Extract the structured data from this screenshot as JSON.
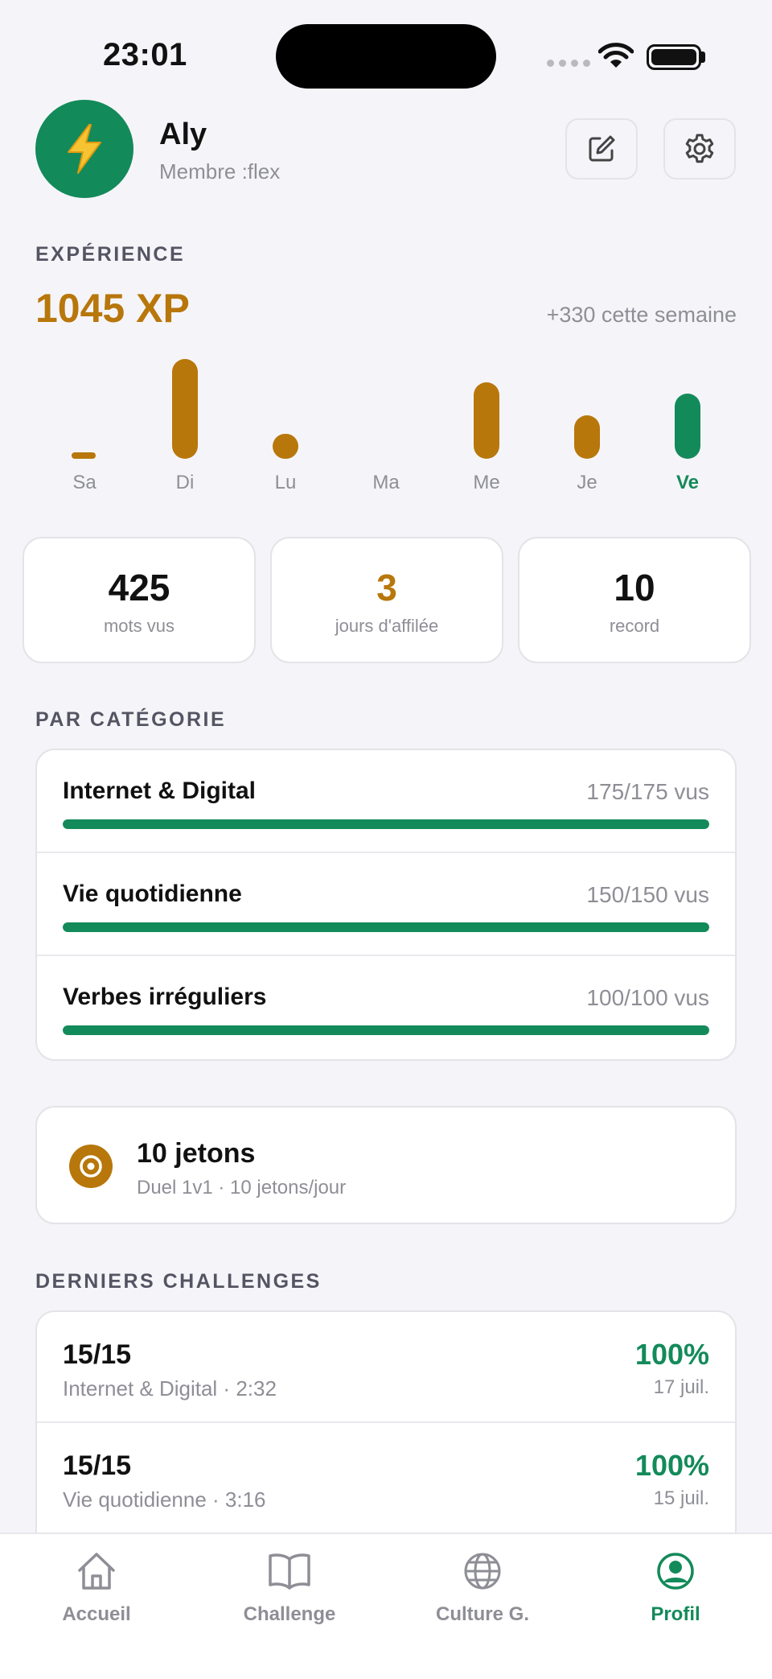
{
  "status_bar": {
    "time": "23:01"
  },
  "profile": {
    "name": "Aly",
    "subtitle": "Membre :flex",
    "avatar_icon": "lightning-bolt-icon",
    "avatar_color": "#138a5a"
  },
  "experience": {
    "label": "EXPÉRIENCE",
    "xp": "1045 XP",
    "week_gain": "+330 cette semaine"
  },
  "chart_data": {
    "type": "bar",
    "categories": [
      "Sa",
      "Di",
      "Lu",
      "Ma",
      "Me",
      "Je",
      "Ve"
    ],
    "values": [
      8,
      120,
      30,
      0,
      92,
      52,
      78
    ],
    "highlight_category": "Ve",
    "colors": {
      "default": "#b8770b",
      "highlight": "#138a5a"
    }
  },
  "stats": [
    {
      "value": "425",
      "label": "mots vus",
      "color": "#111111"
    },
    {
      "value": "3",
      "label": "jours d'affilée",
      "color": "#b8770b"
    },
    {
      "value": "10",
      "label": "record",
      "color": "#111111"
    }
  ],
  "categories": {
    "label": "PAR CATÉGORIE",
    "items": [
      {
        "name": "Internet & Digital",
        "count": "175/175 vus",
        "progress": 1.0
      },
      {
        "name": "Vie quotidienne",
        "count": "150/150 vus",
        "progress": 1.0
      },
      {
        "name": "Verbes irréguliers",
        "count": "100/100 vus",
        "progress": 1.0
      }
    ]
  },
  "tokens": {
    "title": "10 jetons",
    "subtitle": "Duel 1v1 · 10 jetons/jour",
    "icon": "target-icon"
  },
  "challenges": {
    "label": "DERNIERS CHALLENGES",
    "items": [
      {
        "score": "15/15",
        "meta": "Internet & Digital · 2:32",
        "percent": "100%",
        "date": "17 juil."
      },
      {
        "score": "15/15",
        "meta": "Vie quotidienne · 3:16",
        "percent": "100%",
        "date": "15 juil."
      }
    ]
  },
  "tabbar": {
    "tabs": [
      {
        "label": "Accueil",
        "icon": "home-icon"
      },
      {
        "label": "Challenge",
        "icon": "book-icon"
      },
      {
        "label": "Culture G.",
        "icon": "globe-icon"
      },
      {
        "label": "Profil",
        "icon": "profile-icon"
      }
    ],
    "active": "Profil"
  },
  "colors": {
    "accent_green": "#138a5a",
    "accent_gold": "#b8770b",
    "muted": "#8e8e96"
  }
}
